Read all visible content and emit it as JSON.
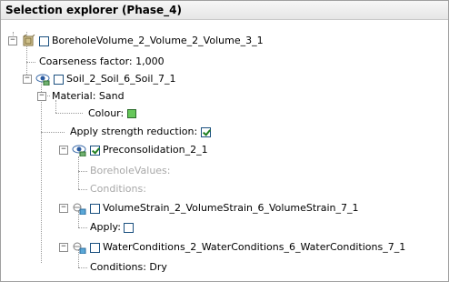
{
  "panel": {
    "title": "Selection explorer (Phase_4)"
  },
  "tree": {
    "root_label": "BoreholeVolume_2_Volume_2_Volume_3_1",
    "coarseness": "Coarseness factor: 1,000",
    "soil_label": "Soil_2_Soil_6_Soil_7_1",
    "material": "Material: Sand",
    "colour": "Colour:",
    "colour_value": "#66c75a",
    "apply_strength": "Apply strength reduction:",
    "apply_strength_checked": true,
    "preconsolidation": "Preconsolidation_2_1",
    "preconsolidation_checked": true,
    "borehole_values": "BoreholeValues:",
    "conditions_disabled": "Conditions:",
    "volume_strain": "VolumeStrain_2_VolumeStrain_6_VolumeStrain_7_1",
    "apply": "Apply:",
    "water_conditions": "WaterConditions_2_WaterConditions_6_WaterConditions_7_1",
    "conditions_dry": "Conditions: Dry"
  },
  "icons": {
    "root": "volume-icon",
    "soil": "eye-icon",
    "preconsolidation": "eye-icon",
    "volume_strain": "magnifier-icon",
    "water_conditions": "magnifier-icon"
  }
}
